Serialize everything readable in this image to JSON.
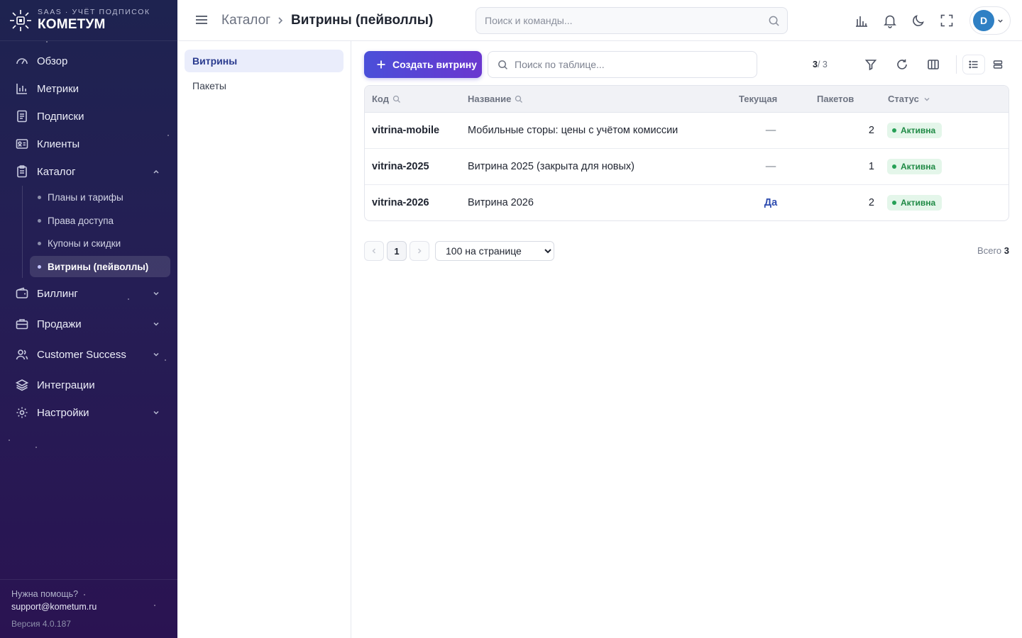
{
  "brand": {
    "tagline": "SAAS · УЧЁТ ПОДПИСОК",
    "name": "КОМЕТУМ"
  },
  "sidebar": {
    "items": [
      {
        "label": "Обзор",
        "icon": "gauge-icon"
      },
      {
        "label": "Метрики",
        "icon": "bar-chart-icon"
      },
      {
        "label": "Подписки",
        "icon": "document-icon"
      },
      {
        "label": "Клиенты",
        "icon": "id-card-icon"
      },
      {
        "label": "Каталог",
        "icon": "clipboard-icon",
        "expanded": true
      },
      {
        "label": "Биллинг",
        "icon": "wallet-icon"
      },
      {
        "label": "Продажи",
        "icon": "briefcase-icon"
      },
      {
        "label": "Customer Success",
        "icon": "users-icon"
      },
      {
        "label": "Интеграции",
        "icon": "layers-icon"
      },
      {
        "label": "Настройки",
        "icon": "gear-icon"
      }
    ],
    "catalog_sub": [
      {
        "label": "Планы и тарифы"
      },
      {
        "label": "Права доступа"
      },
      {
        "label": "Купоны и скидки"
      },
      {
        "label": "Витрины (пейволлы)",
        "active": true
      }
    ],
    "footer": {
      "help": "Нужна помощь?",
      "email": "support@kometum.ru",
      "version": "Версия 4.0.187"
    }
  },
  "topbar": {
    "breadcrumb": [
      "Каталог",
      "Витрины (пейволлы)"
    ],
    "search_placeholder": "Поиск и команды...",
    "avatar_letter": "D",
    "icons": [
      "chart-icon",
      "bell-icon",
      "moon-icon",
      "fullscreen-icon"
    ]
  },
  "subnav": [
    {
      "label": "Витрины",
      "active": true
    },
    {
      "label": "Пакеты"
    }
  ],
  "toolbar": {
    "create_label": "Создать витрину",
    "search_placeholder": "Поиск по таблице...",
    "count_shown": "3",
    "count_total": "/ 3"
  },
  "table": {
    "columns": [
      "Код",
      "Название",
      "Текущая",
      "Пакетов",
      "Статус"
    ],
    "rows": [
      {
        "code": "vitrina-mobile",
        "name": "Мобильные сторы: цены с учётом комиссии",
        "current": "—",
        "packages": "2",
        "status": "Активна"
      },
      {
        "code": "vitrina-2025",
        "name": "Витрина 2025 (закрыта для новых)",
        "current": "—",
        "packages": "1",
        "status": "Активна"
      },
      {
        "code": "vitrina-2026",
        "name": "Витрина 2026",
        "current": "Да",
        "packages": "2",
        "status": "Активна"
      }
    ]
  },
  "pagination": {
    "current_page": "1",
    "page_size": "100 на странице",
    "total_label": "Всего",
    "total_value": "3"
  },
  "colors": {
    "accent": "#4a4fd9",
    "sidebar_bg": "#1e2350",
    "status_active": "#1f8a45",
    "active_bg": "#eaedfb"
  }
}
